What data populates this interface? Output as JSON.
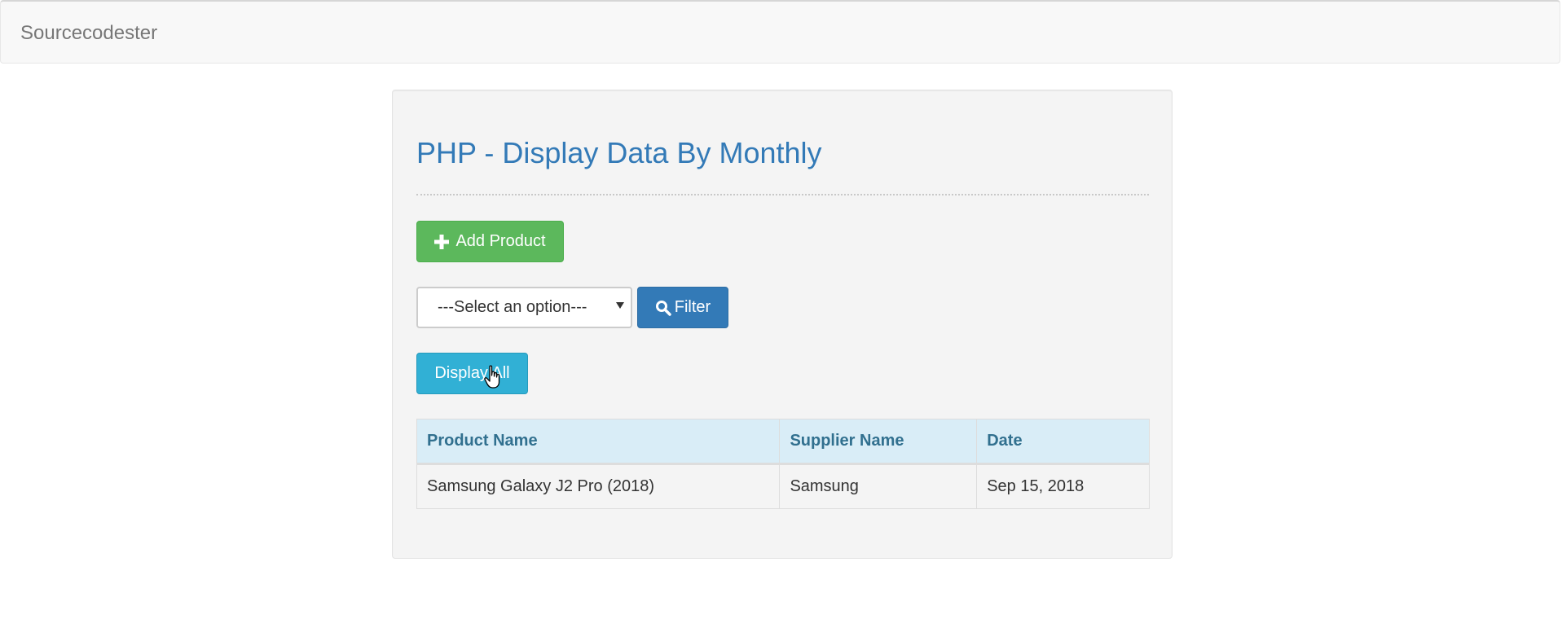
{
  "navbar": {
    "brand": "Sourcecodester"
  },
  "main": {
    "title": "PHP - Display Data By Monthly",
    "add_button_label": "Add Product",
    "select": {
      "selected_value": "---Select an option---"
    },
    "filter_button_label": "Filter",
    "display_all_button_label": "Display All"
  },
  "table": {
    "headers": [
      "Product Name",
      "Supplier Name",
      "Date"
    ],
    "rows": [
      [
        "Samsung Galaxy J2 Pro (2018)",
        "Samsung",
        "Sep 15, 2018"
      ]
    ]
  },
  "icons": {
    "add": "plus-icon",
    "filter": "search-icon",
    "select": "chevron-down-icon",
    "cursor": "hand-pointer-icon"
  },
  "colors": {
    "brand_text": "#777777",
    "title": "#337ab7",
    "success": "#5cb85c",
    "primary": "#337ab7",
    "info": "#31b0d5",
    "table_header_bg": "#d9edf7",
    "table_header_text": "#31708f"
  }
}
